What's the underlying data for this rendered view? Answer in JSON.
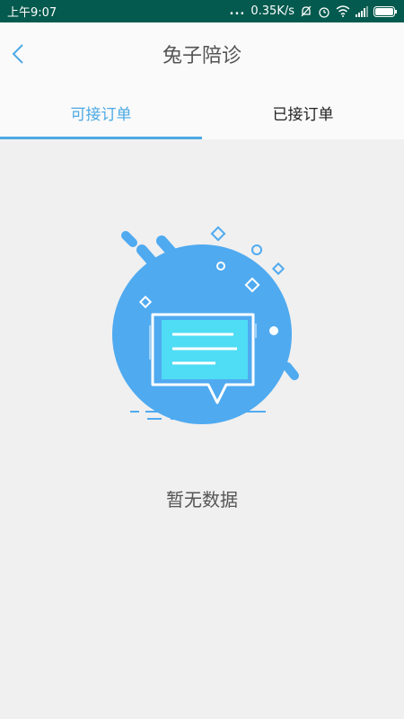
{
  "status_bar": {
    "time": "上午9:07",
    "dots": "...",
    "speed": "0.35K/s"
  },
  "nav": {
    "title": "兔子陪诊",
    "back_icon": "chevron-left-icon"
  },
  "tabs": [
    {
      "label": "可接订单",
      "active": true
    },
    {
      "label": "已接订单",
      "active": false
    }
  ],
  "empty_state": {
    "message": "暂无数据",
    "icon": "empty-message-illustration"
  },
  "colors": {
    "status_bar": "#045a4e",
    "accent": "#4da9e4",
    "background": "#f0f0f0"
  }
}
